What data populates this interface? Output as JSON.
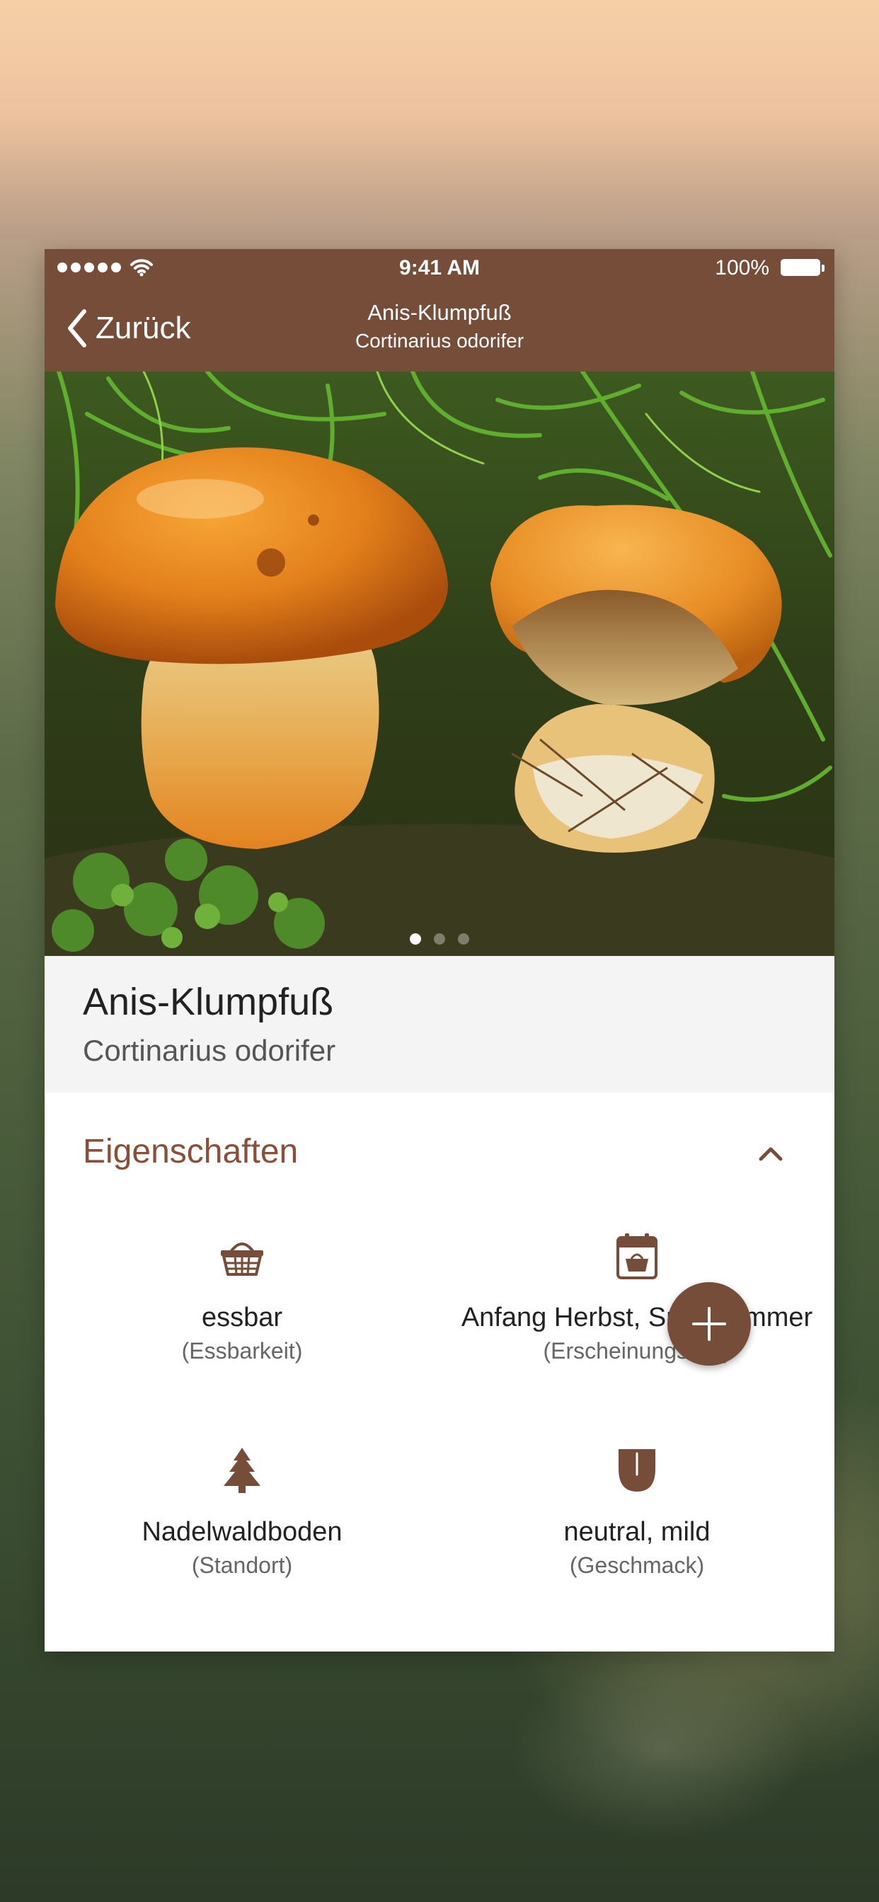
{
  "status_bar": {
    "time": "9:41 AM",
    "battery_percent": "100%",
    "signal_dots": 5
  },
  "nav": {
    "back_label": "Zurück",
    "title": "Anis-Klumpfuß",
    "subtitle": "Cortinarius odorifer",
    "background_color": "#754d39"
  },
  "photo": {
    "page_count": 3,
    "current_page": 1
  },
  "species": {
    "common_name": "Anis-Klumpfuß",
    "latin_name": "Cortinarius odorifer"
  },
  "properties": {
    "title": "Eigenschaften",
    "expanded": true,
    "items": [
      {
        "icon": "basket-icon",
        "value": "essbar",
        "label": "(Essbarkeit)"
      },
      {
        "icon": "calendar-basket-icon",
        "value": "Anfang Herbst, Spät Sommer",
        "label": "(Erscheinungszeit)"
      },
      {
        "icon": "conifer-tree-icon",
        "value": "Nadelwaldboden",
        "label": "(Standort)"
      },
      {
        "icon": "tongue-icon",
        "value": "neutral, mild",
        "label": "(Geschmack)"
      }
    ]
  },
  "colors": {
    "accent": "#754d39",
    "section_title": "#8a4f38"
  }
}
